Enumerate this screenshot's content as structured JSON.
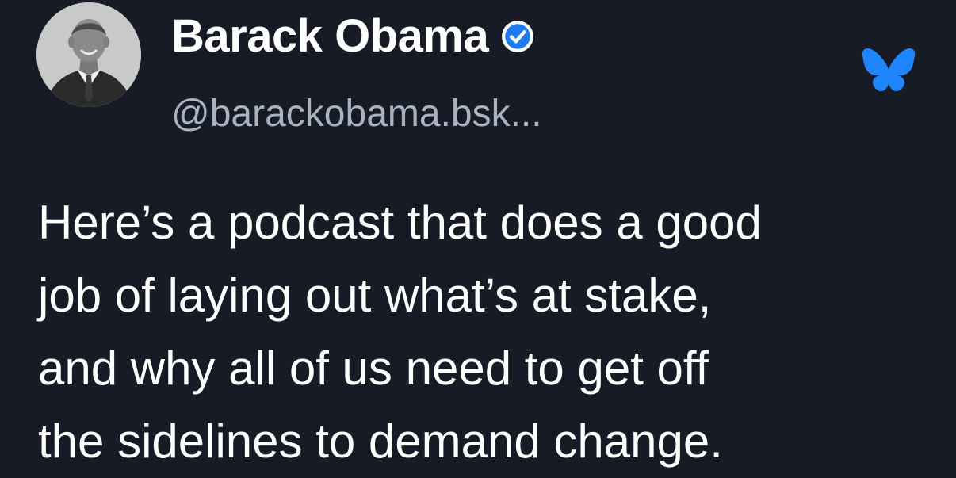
{
  "post": {
    "author": {
      "display_name": "Barack Obama",
      "handle": "@barackobama.bsk...",
      "verified": true,
      "avatar": "profile-photo"
    },
    "platform_icon": "bluesky-butterfly-icon",
    "text_lines": [
      "Here’s a podcast that does a good",
      "job of laying out what’s at stake,",
      "and why all of us need to get off",
      "the sidelines to demand change."
    ]
  },
  "colors": {
    "background": "#161b25",
    "text_primary": "#ffffff",
    "text_secondary": "#a9b2bf",
    "verified_badge": "#1d7bf2",
    "bluesky_blue": "#1f85ff"
  }
}
